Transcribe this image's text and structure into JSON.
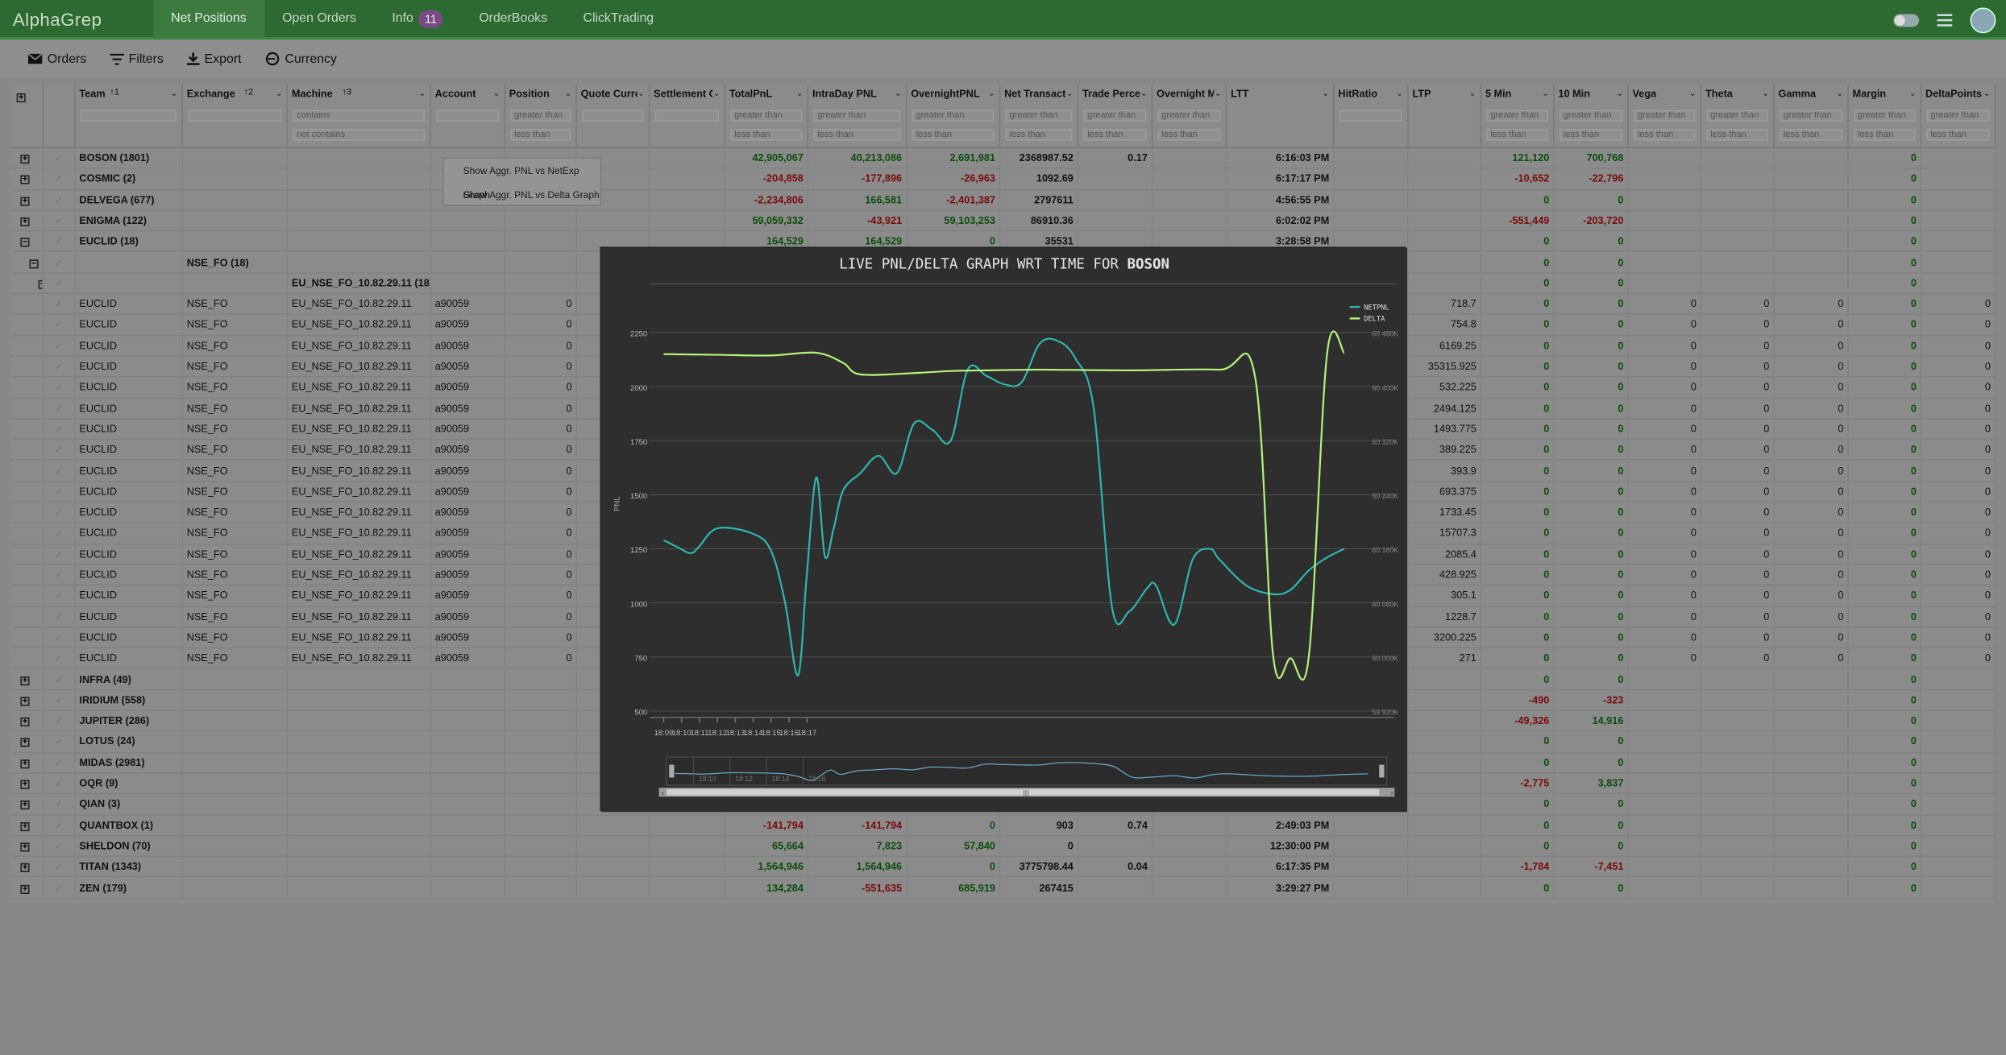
{
  "app": {
    "brand": "AlphaGrep",
    "tabs": [
      "Net Positions",
      "Open Orders",
      "Info",
      "OrderBooks",
      "ClickTrading"
    ],
    "active_tab": "Net Positions",
    "info_badge": "11"
  },
  "toolbar": {
    "orders": "Orders",
    "filters": "Filters",
    "export": "Export",
    "currency": "Currency"
  },
  "columns": [
    {
      "label": "Team",
      "sort": "↑1",
      "filter": [
        ""
      ]
    },
    {
      "label": "Exchange",
      "sort": "↑2",
      "filter": [
        ""
      ]
    },
    {
      "label": "Machine",
      "sort": "↑3",
      "filter": [
        "contains",
        "not contains"
      ]
    },
    {
      "label": "Account",
      "filter": [
        ""
      ]
    },
    {
      "label": "Position",
      "filter": [
        "greater than",
        "less than"
      ]
    },
    {
      "label": "Quote Curren:",
      "filter": [
        ""
      ]
    },
    {
      "label": "Settlement Cu",
      "filter": [
        ""
      ]
    },
    {
      "label": "TotalPnL",
      "filter": [
        "greater than",
        "less than"
      ]
    },
    {
      "label": "IntraDay PNL",
      "filter": [
        "greater than",
        "less than"
      ]
    },
    {
      "label": "OvernightPNL",
      "filter": [
        "greater than",
        "less than"
      ]
    },
    {
      "label": "Net Transacti:",
      "filter": [
        "greater than",
        "less than"
      ]
    },
    {
      "label": "Trade Percenc",
      "filter": [
        "greater than",
        "less than"
      ]
    },
    {
      "label": "Overnight M:",
      "filter": [
        "greater than",
        "less than"
      ]
    },
    {
      "label": "LTT",
      "filter": []
    },
    {
      "label": "HitRatio",
      "filter": [
        ""
      ]
    },
    {
      "label": "LTP",
      "filter": []
    },
    {
      "label": "5 Min",
      "filter": [
        "greater than",
        "less than"
      ]
    },
    {
      "label": "10 Min",
      "filter": [
        "greater than",
        "less than"
      ]
    },
    {
      "label": "Vega",
      "filter": [
        "greater than",
        "less than"
      ]
    },
    {
      "label": "Theta",
      "filter": [
        "greater than",
        "less than"
      ]
    },
    {
      "label": "Gamma",
      "filter": [
        "greater than",
        "less than"
      ]
    },
    {
      "label": "Margin",
      "filter": [
        "greater than",
        "less than"
      ]
    },
    {
      "label": "DeltaPoints",
      "filter": [
        "greater than",
        "less than"
      ]
    }
  ],
  "groups_top": [
    {
      "team": "BOSON (1801)",
      "total": "42,905,067",
      "intraday": "40,213,086",
      "overnight": "2,691,981",
      "nettx": "2368987.52",
      "trade": "0.17",
      "ltt": "6:16:03 PM",
      "m5": "121,120",
      "m10": "700,768",
      "margin": "0"
    },
    {
      "team": "COSMIC (2)",
      "total": "-204,858",
      "intraday": "-177,896",
      "overnight": "-26,963",
      "nettx": "1092.69",
      "trade": "",
      "ltt": "6:17:17 PM",
      "m5": "-10,652",
      "m10": "-22,796",
      "margin": "0"
    },
    {
      "team": "DELVEGA (677)",
      "total": "-2,234,806",
      "intraday": "166,581",
      "overnight": "-2,401,387",
      "nettx": "2797611",
      "trade": "",
      "ltt": "4:56:55 PM",
      "m5": "0",
      "m10": "0",
      "margin": "0"
    },
    {
      "team": "ENIGMA (122)",
      "total": "59,059,332",
      "intraday": "-43,921",
      "overnight": "59,103,253",
      "nettx": "86910.36",
      "trade": "",
      "ltt": "6:02:02 PM",
      "m5": "-551,449",
      "m10": "-203,720",
      "margin": "0"
    },
    {
      "team": "EUCLID (18)",
      "total": "164,529",
      "intraday": "164,529",
      "overnight": "0",
      "nettx": "35531",
      "trade": "",
      "ltt": "3:28:58 PM",
      "m5": "0",
      "m10": "0",
      "margin": "0"
    }
  ],
  "subgroup_exchange": {
    "label": "NSE_FO (18)",
    "m5": "0",
    "m10": "0",
    "margin": "0"
  },
  "subgroup_machine": {
    "label": "EU_NSE_FO_10.82.29.11 (18)",
    "m5": "0",
    "m10": "0",
    "margin": "0"
  },
  "leaf_common": {
    "team": "EUCLID",
    "exchange": "NSE_FO",
    "machine": "EU_NSE_FO_10.82.29.11",
    "account": "a90059",
    "position": "0",
    "m5": "0",
    "m10": "0",
    "vega": "0",
    "theta": "0",
    "gamma": "0",
    "margin": "0",
    "delta": "0"
  },
  "leaf_ltp": [
    "718.7",
    "754.8",
    "6169.25",
    "35315.925",
    "532.225",
    "2494.125",
    "1493.775",
    "389.225",
    "393.9",
    "693.375",
    "1733.45",
    "15707.3",
    "2085.4",
    "428.925",
    "305.1",
    "1228.7",
    "3200.225",
    "271"
  ],
  "groups_bottom": [
    {
      "team": "INFRA (49)",
      "m5": "0",
      "m10": "0",
      "margin": "0"
    },
    {
      "team": "IRIDIUM (558)",
      "m5": "-490",
      "m10": "-323",
      "margin": "0"
    },
    {
      "team": "JUPITER (286)",
      "m5": "-49,326",
      "m10": "14,916",
      "margin": "0"
    },
    {
      "team": "LOTUS (24)",
      "m5": "0",
      "m10": "0",
      "margin": "0"
    },
    {
      "team": "MIDAS (2981)",
      "m5": "0",
      "m10": "0",
      "margin": "0"
    },
    {
      "team": "OQR (9)",
      "m5": "-2,775",
      "m10": "3,837",
      "margin": "0"
    },
    {
      "team": "QIAN (3)",
      "m5": "0",
      "m10": "0",
      "margin": "0"
    },
    {
      "team": "QUANTBOX (1)",
      "total": "-141,794",
      "intraday": "-141,794",
      "overnight": "0",
      "nettx": "903",
      "trade": "0.74",
      "ltt": "2:49:03 PM",
      "m5": "0",
      "m10": "0",
      "margin": "0"
    },
    {
      "team": "SHELDON (70)",
      "total": "65,664",
      "intraday": "7,823",
      "overnight": "57,840",
      "nettx": "0",
      "trade": "",
      "ltt": "12:30:00 PM",
      "m5": "0",
      "m10": "0",
      "margin": "0"
    },
    {
      "team": "TITAN (1343)",
      "total": "1,564,946",
      "intraday": "1,564,946",
      "overnight": "0",
      "nettx": "3775798.44",
      "trade": "0.04",
      "ltt": "6:17:35 PM",
      "m5": "-1,784",
      "m10": "-7,451",
      "margin": "0"
    },
    {
      "team": "ZEN (179)",
      "total": "134,284",
      "intraday": "-551,635",
      "overnight": "685,919",
      "nettx": "267415",
      "trade": "",
      "ltt": "3:29:27 PM",
      "m5": "0",
      "m10": "0",
      "margin": "0"
    }
  ],
  "context_menu": [
    "Show Aggr. PNL vs NetExp Graph",
    "Show Aggr. PNL vs Delta Graph"
  ],
  "chart_title_prefix": "LIVE PNL/DELTA GRAPH WRT TIME FOR ",
  "chart_title_team": "BOSON",
  "chart_data": {
    "type": "line",
    "ylabel": "PNL",
    "ylim": [
      500,
      2250
    ],
    "y_ticks": [
      "2250",
      "2000",
      "1750",
      "1500",
      "1250",
      "1000",
      "750",
      "500"
    ],
    "y2_ticks": [
      "60 480K",
      "60 400K",
      "60 320K",
      "60 240K",
      "60 160K",
      "60 080K",
      "60 000K",
      "59 920K"
    ],
    "x_ticks": [
      "18:09",
      "18:10",
      "18:11",
      "18:12",
      "18:13",
      "18:14",
      "18:15",
      "18:16",
      "18:17"
    ],
    "navigator_ticks": [
      "18:10",
      "18:12",
      "18:14",
      "18:16"
    ],
    "legend_position": "top-right",
    "series": [
      {
        "name": "NETPNL",
        "color": "#2fb5ad",
        "x": [
          18.15,
          18.162,
          18.175,
          18.183,
          18.2,
          18.233,
          18.25,
          18.263,
          18.275,
          18.283,
          18.292,
          18.3,
          18.308,
          18.317,
          18.333,
          18.35,
          18.367,
          18.383,
          18.4,
          18.417,
          18.433,
          18.45,
          18.467,
          18.483,
          18.5,
          18.517,
          18.533,
          18.55,
          18.567,
          18.583,
          18.6,
          18.608,
          18.625,
          18.642,
          18.658,
          18.667,
          18.692,
          18.717,
          18.733,
          18.75,
          18.767,
          18.783
        ],
        "y": [
          1290,
          1260,
          1230,
          1260,
          1345,
          1320,
          1240,
          1000,
          665,
          1120,
          1580,
          1215,
          1340,
          1520,
          1600,
          1680,
          1600,
          1830,
          1800,
          1750,
          2080,
          2050,
          2010,
          2020,
          2200,
          2210,
          2130,
          1900,
          980,
          960,
          1070,
          1080,
          900,
          1200,
          1250,
          1200,
          1080,
          1040,
          1060,
          1150,
          1210,
          1250
        ]
      },
      {
        "name": "DELTA",
        "color": "#b6f07a",
        "x": [
          18.15,
          18.2,
          18.25,
          18.292,
          18.317,
          18.333,
          18.383,
          18.417,
          18.45,
          18.5,
          18.583,
          18.667,
          18.7,
          18.717,
          18.733,
          18.75,
          18.767,
          18.783
        ],
        "y": [
          60448,
          60447,
          60446,
          60450,
          60435,
          60418,
          60420,
          60423,
          60424,
          60425,
          60424,
          60425,
          60415,
          60000,
          59998,
          60000,
          60448,
          60450
        ]
      }
    ]
  }
}
